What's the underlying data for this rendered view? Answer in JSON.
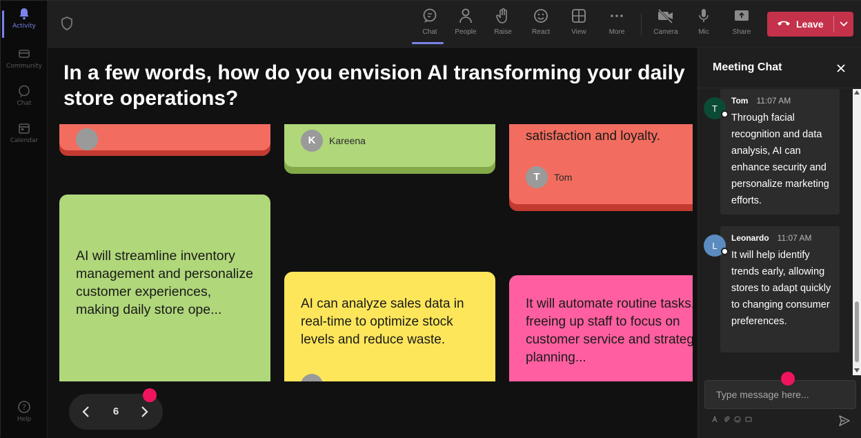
{
  "rail": {
    "items": [
      {
        "label": "Activity",
        "icon": "bell-icon"
      },
      {
        "label": "Community",
        "icon": "community-icon"
      },
      {
        "label": "Chat",
        "icon": "chat-icon"
      },
      {
        "label": "Calendar",
        "icon": "calendar-icon"
      },
      {
        "label": "Help",
        "icon": "help-icon"
      }
    ]
  },
  "toolbar": {
    "chat": "Chat",
    "people": "People",
    "raise": "Raise",
    "react": "React",
    "view": "View",
    "more": "More",
    "camera": "Camera",
    "mic": "Mic",
    "share": "Share",
    "leave": "Leave"
  },
  "stage": {
    "question": "In a few words, how do you envision AI transforming your daily store operations?",
    "notes": [
      {
        "id": "red1",
        "text": "",
        "author": "",
        "initial": ""
      },
      {
        "id": "green1",
        "text": "",
        "author": "Kareena",
        "initial": "K"
      },
      {
        "id": "red2",
        "text": "satisfaction and loyalty.",
        "author": "Tom",
        "initial": "T"
      },
      {
        "id": "green2",
        "text": "AI will streamline inventory management and personalize customer experiences, making daily store ope...",
        "author": "",
        "initial": ""
      },
      {
        "id": "yellow",
        "text": "AI can analyze sales data in real-time to optimize stock levels and reduce waste.",
        "author": "",
        "initial": ""
      },
      {
        "id": "pink",
        "text": "It will automate routine tasks, freeing up staff to focus on customer service and strategic planning...",
        "author": "",
        "initial": ""
      }
    ],
    "page": "6"
  },
  "chat": {
    "title": "Meeting Chat",
    "messages": [
      {
        "sender": "Tom",
        "initial": "T",
        "time": "11:07 AM",
        "text": "Through facial recognition and data analysis, AI can enhance security and personalize marketing efforts.",
        "color": "#0b4a35"
      },
      {
        "sender": "Leonardo",
        "initial": "L",
        "time": "11:07 AM",
        "text": "It will help identify trends early, allowing stores to adapt quickly to changing consumer preferences.",
        "color": "#5b8cc0"
      }
    ],
    "input_placeholder": "Type message here..."
  },
  "colors": {
    "accent": "#7b83eb",
    "leave": "#c4314b",
    "notification": "#f0145e"
  }
}
